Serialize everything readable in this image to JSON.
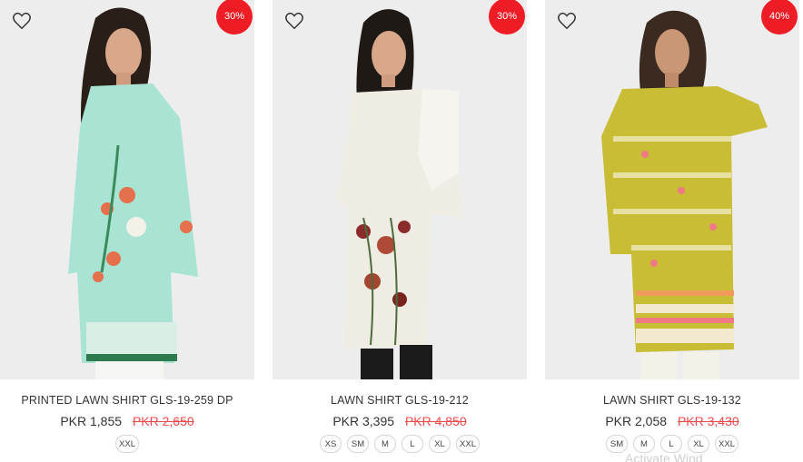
{
  "products": [
    {
      "name": "PRINTED LAWN SHIRT GLS-19-259 DP",
      "price": "PKR 1,855",
      "old_price": "PKR 2,650",
      "discount": "30%",
      "sizes": [
        "XXL"
      ],
      "shirt_color": "#a8e3d4"
    },
    {
      "name": "LAWN SHIRT GLS-19-212",
      "price": "PKR 3,395",
      "old_price": "PKR 4,850",
      "discount": "30%",
      "sizes": [
        "XS",
        "SM",
        "M",
        "L",
        "XL",
        "XXL"
      ],
      "shirt_color": "#efece3"
    },
    {
      "name": "LAWN SHIRT GLS-19-132",
      "price": "PKR 2,058",
      "old_price": "PKR 3,430",
      "discount": "40%",
      "sizes": [
        "SM",
        "M",
        "L",
        "XL",
        "XXL"
      ],
      "shirt_color": "#c9bd36"
    }
  ],
  "watermark": "Activate Wind",
  "colors": {
    "badge": "#ee1c25",
    "old_price": "#ee4b4b"
  }
}
